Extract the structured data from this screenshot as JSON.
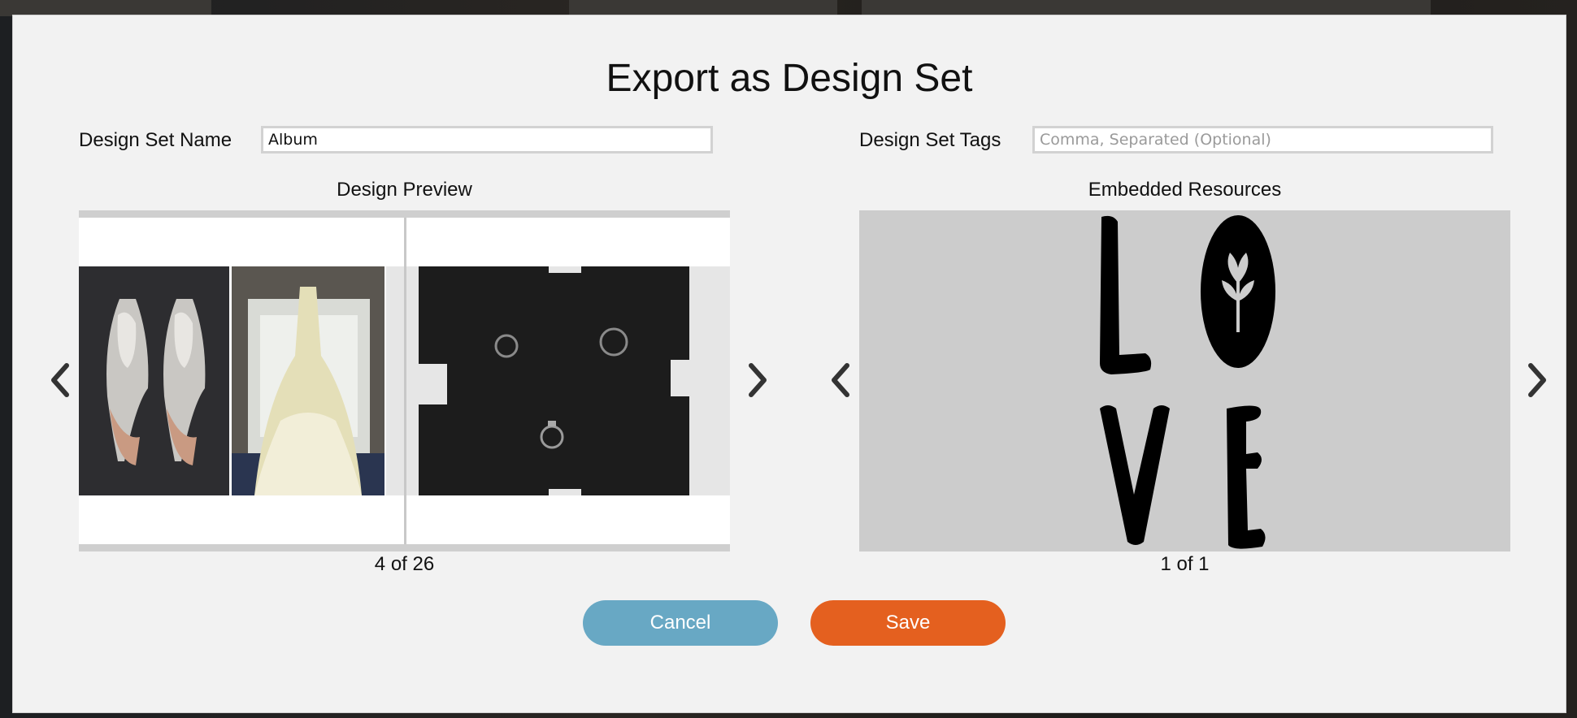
{
  "dialog": {
    "title": "Export as Design Set"
  },
  "fields": {
    "name_label": "Design Set Name",
    "name_value": "Album",
    "tags_label": "Design Set Tags",
    "tags_value": "",
    "tags_placeholder": "Comma, Separated (Optional)"
  },
  "design_preview": {
    "title": "Design Preview",
    "counter": "4 of 26",
    "current": 4,
    "total": 26
  },
  "embedded_resources": {
    "title": "Embedded Resources",
    "counter": "1 of 1",
    "current": 1,
    "total": 1
  },
  "buttons": {
    "cancel_label": "Cancel",
    "save_label": "Save"
  },
  "icons": {
    "prev": "chevron-left-icon",
    "next": "chevron-right-icon"
  },
  "colors": {
    "cancel": "#68a8c4",
    "save": "#e4601f",
    "dialog_bg": "#f2f2f2"
  }
}
